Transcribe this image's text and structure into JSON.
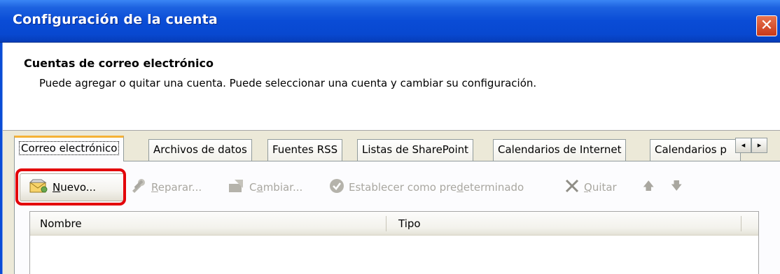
{
  "window": {
    "title": "Configuración de la cuenta",
    "close_glyph": "✕"
  },
  "header": {
    "title": "Cuentas de correo electrónico",
    "subtitle": "Puede agregar o quitar una cuenta. Puede seleccionar una cuenta y cambiar su configuración."
  },
  "tabs": [
    {
      "label": "Correo electrónico",
      "active": true
    },
    {
      "label": "Archivos de datos"
    },
    {
      "label": "Fuentes RSS"
    },
    {
      "label": "Listas de SharePoint"
    },
    {
      "label": "Calendarios de Internet"
    },
    {
      "label": "Calendarios p"
    }
  ],
  "tab_scroll": {
    "left": "◂",
    "right": "▸"
  },
  "toolbar": {
    "nuevo": {
      "pre": "",
      "u": "N",
      "post": "uevo..."
    },
    "reparar": {
      "pre": "",
      "u": "R",
      "post": "eparar..."
    },
    "cambiar": {
      "pre": "C",
      "u": "a",
      "post": "mbiar..."
    },
    "predeterminado": {
      "pre": "Establecer como pre",
      "u": "d",
      "post": "eterminado"
    },
    "quitar": {
      "pre": "",
      "u": "Q",
      "post": "uitar"
    },
    "up_glyph": "🡅",
    "down_glyph": "🡇"
  },
  "list": {
    "columns": [
      "Nombre",
      "Tipo"
    ]
  },
  "colors": {
    "highlight": "#e3040a",
    "titlebar": "#0a4cd6",
    "active_tab_accent": "#f5b237"
  }
}
